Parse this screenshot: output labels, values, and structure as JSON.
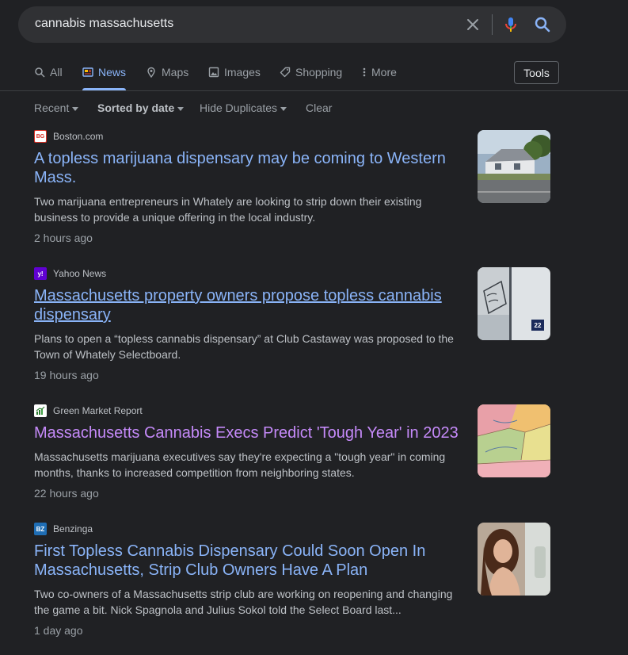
{
  "search": {
    "query": "cannabis massachusetts"
  },
  "tabs": [
    {
      "label": "All",
      "icon": "search-icon",
      "active": false
    },
    {
      "label": "News",
      "icon": "news-icon",
      "active": true
    },
    {
      "label": "Maps",
      "icon": "map-pin-icon",
      "active": false
    },
    {
      "label": "Images",
      "icon": "image-icon",
      "active": false
    },
    {
      "label": "Shopping",
      "icon": "tag-icon",
      "active": false
    },
    {
      "label": "More",
      "icon": "more-vert-icon",
      "active": false
    }
  ],
  "tools_label": "Tools",
  "filters": {
    "recent": "Recent",
    "sorted": "Sorted by date",
    "duplicates": "Hide Duplicates",
    "clear": "Clear"
  },
  "results": [
    {
      "source": "Boston.com",
      "title": "A topless marijuana dispensary may be coming to Western Mass.",
      "snippet": "Two marijuana entrepreneurs in Whately are looking to strip down their existing business to provide a unique offering in the local industry.",
      "time": "2 hours ago",
      "thumbnail": "building-photo"
    },
    {
      "source": "Yahoo News",
      "title": "Massachusetts property owners propose topless cannabis dispensary",
      "snippet": "Plans to open a “topless cannabis dispensary” at Club Castaway was proposed to the Town of Whately Selectboard.",
      "time": "19 hours ago",
      "thumbnail": "sign-photo",
      "thumbnail_badge": "22"
    },
    {
      "source": "Green Market Report",
      "title": "Massachusetts Cannabis Execs Predict 'Tough Year' in 2023",
      "snippet": "Massachusetts marijuana executives say they're expecting a \"tough year\" in coming months, thanks to increased competition from neighboring states.",
      "time": "22 hours ago",
      "thumbnail": "map-photo"
    },
    {
      "source": "Benzinga",
      "title": "First Topless Cannabis Dispensary Could Soon Open In Massachusetts, Strip Club Owners Have A Plan",
      "snippet": "Two co-owners of a Massachusetts strip club are working on reopening and changing the game a bit. Nick Spagnola and Julius Sokol told the Select Board last...",
      "time": "1 day ago",
      "thumbnail": "portrait-photo"
    }
  ],
  "favicons": {
    "boston": "BG",
    "yahoo": "y!",
    "benzinga": "BZ"
  },
  "colors": {
    "background": "#202124",
    "link": "#8ab4f8",
    "visited_link": "#c58af9",
    "text": "#bdc1c6",
    "muted": "#9aa0a6"
  }
}
